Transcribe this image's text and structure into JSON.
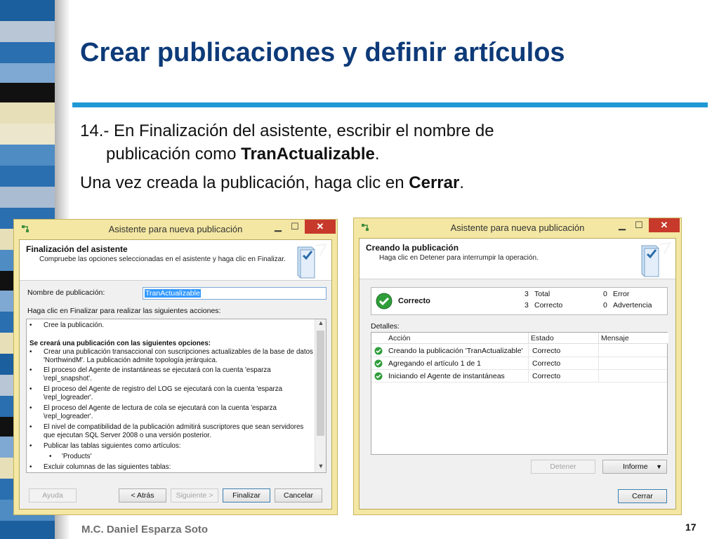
{
  "slide": {
    "title": "Crear publicaciones y definir artículos",
    "step_line1": "14.- En Finalización del asistente, escribir el nombre de",
    "step_line2_prefix": "publicación como ",
    "step_line2_bold": "TranActualizable",
    "step_line2_suffix": ".",
    "close_prefix": "Una vez creada la publicación, haga clic en ",
    "close_bold": "Cerrar",
    "close_suffix": ".",
    "author": "M.C. Daniel Esparza Soto",
    "page_number": "17",
    "accent_color": "#1f98d6",
    "title_color": "#0d3a78"
  },
  "left_dialog": {
    "window_title": "Asistente para nueva publicación",
    "header_title": "Finalización del asistente",
    "header_subtitle": "Compruebe las opciones seleccionadas en el asistente y haga clic en Finalizar.",
    "name_label": "Nombre de publicación:",
    "name_value": "TranActualizable",
    "actions_label": "Haga clic en Finalizar para realizar las siguientes acciones:",
    "actions": [
      {
        "bullet": "•",
        "text": "Cree la publicación."
      },
      {
        "bullet": "",
        "text": "Se creará una publicación con las siguientes opciones:"
      },
      {
        "bullet": "•",
        "text": "Crear una publicación transaccional con suscripciones actualizables de la base de datos 'NorthwindM'. La publicación admite topología jerárquica."
      },
      {
        "bullet": "•",
        "text": "El proceso del Agente de instantáneas se ejecutará con la cuenta 'esparza \\repl_snapshot'."
      },
      {
        "bullet": "•",
        "text": "El proceso del Agente de registro del LOG se ejecutará con la cuenta 'esparza \\repl_logreader'."
      },
      {
        "bullet": "•",
        "text": "El proceso del Agente de lectura de cola se ejecutará con la cuenta 'esparza \\repl_logreader'."
      },
      {
        "bullet": "•",
        "text": "El nivel de compatibilidad de la publicación admitirá suscriptores que sean servidores que ejecutan SQL Server 2008 o una versión posterior."
      },
      {
        "bullet": "•",
        "text": "Publicar las tablas siguientes como artículos:"
      },
      {
        "bullet": "•",
        "text": "'Products'"
      },
      {
        "bullet": "•",
        "text": "Excluir columnas de las siguientes tablas:"
      }
    ],
    "buttons": {
      "help": "Ayuda",
      "back": "< Atrás",
      "next": "Siguiente >",
      "finish": "Finalizar",
      "cancel": "Cancelar"
    }
  },
  "right_dialog": {
    "window_title": "Asistente para nueva publicación",
    "header_title": "Creando la publicación",
    "header_subtitle": "Haga clic en Detener para interrumpir la operación.",
    "status": "Correcto",
    "totals": [
      {
        "count": "3",
        "label": "Total"
      },
      {
        "count": "3",
        "label": "Correcto"
      }
    ],
    "errors": [
      {
        "count": "0",
        "label": "Error"
      },
      {
        "count": "0",
        "label": "Advertencia"
      }
    ],
    "details_label": "Detalles:",
    "columns": [
      "Acción",
      "Estado",
      "Mensaje"
    ],
    "rows": [
      {
        "action": "Creando la publicación 'TranActualizable'",
        "state": "Correcto",
        "message": ""
      },
      {
        "action": "Agregando el artículo 1 de 1",
        "state": "Correcto",
        "message": ""
      },
      {
        "action": "Iniciando el Agente de instantáneas",
        "state": "Correcto",
        "message": ""
      }
    ],
    "buttons": {
      "stop": "Detener",
      "report": "Informe",
      "close": "Cerrar"
    }
  }
}
